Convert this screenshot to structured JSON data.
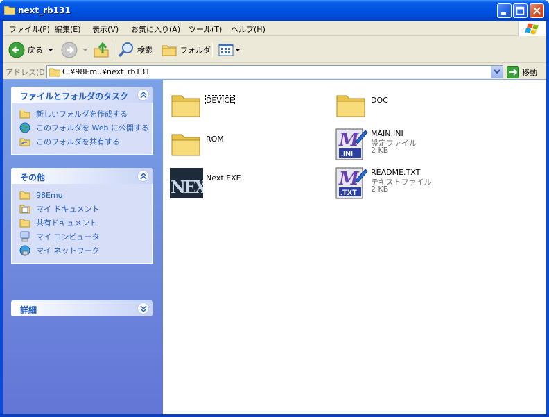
{
  "window": {
    "title": "next_rb131",
    "controls": [
      "minimize",
      "maximize",
      "close"
    ]
  },
  "menu": {
    "items": [
      "ファイル(F)",
      "編集(E)",
      "表示(V)",
      "お気に入り(A)",
      "ツール(T)",
      "ヘルプ(H)"
    ]
  },
  "toolbar": {
    "back_label": "戻る",
    "search_label": "検索",
    "folders_label": "フォルダ"
  },
  "address": {
    "label": "アドレス(D)",
    "path": "C:¥98Emu¥next_rb131",
    "go_label": "移動"
  },
  "sidebar": {
    "panels": [
      {
        "title": "ファイルとフォルダのタスク",
        "items": [
          "新しいフォルダを作成する",
          "このフォルダを Web に公開する",
          "このフォルダを共有する"
        ]
      },
      {
        "title": "その他",
        "items": [
          "98Emu",
          "マイ ドキュメント",
          "共有ドキュメント",
          "マイ コンピュータ",
          "マイ ネットワーク"
        ]
      },
      {
        "title": "詳細",
        "items": []
      }
    ]
  },
  "files": [
    {
      "name": "DEVICE",
      "type": "folder",
      "subtitle": "",
      "size": ""
    },
    {
      "name": "DOC",
      "type": "folder",
      "subtitle": "",
      "size": ""
    },
    {
      "name": "ROM",
      "type": "folder",
      "subtitle": "",
      "size": ""
    },
    {
      "name": "MAIN.INI",
      "type": "ini",
      "subtitle": "設定ファイル",
      "size": "2 KB"
    },
    {
      "name": "Next.EXE",
      "type": "exe",
      "subtitle": "",
      "size": ""
    },
    {
      "name": "README.TXT",
      "type": "txt",
      "subtitle": "テキストファイル",
      "size": "2 KB"
    }
  ],
  "icon_badges": {
    "ini": ".INI",
    "txt": ".TXT",
    "exe": "NEXT"
  },
  "colors": {
    "title_blue": "#0054e3",
    "task_link": "#215dc6",
    "sidebar_top": "#7ba2e7",
    "sidebar_bottom": "#6375d6"
  }
}
